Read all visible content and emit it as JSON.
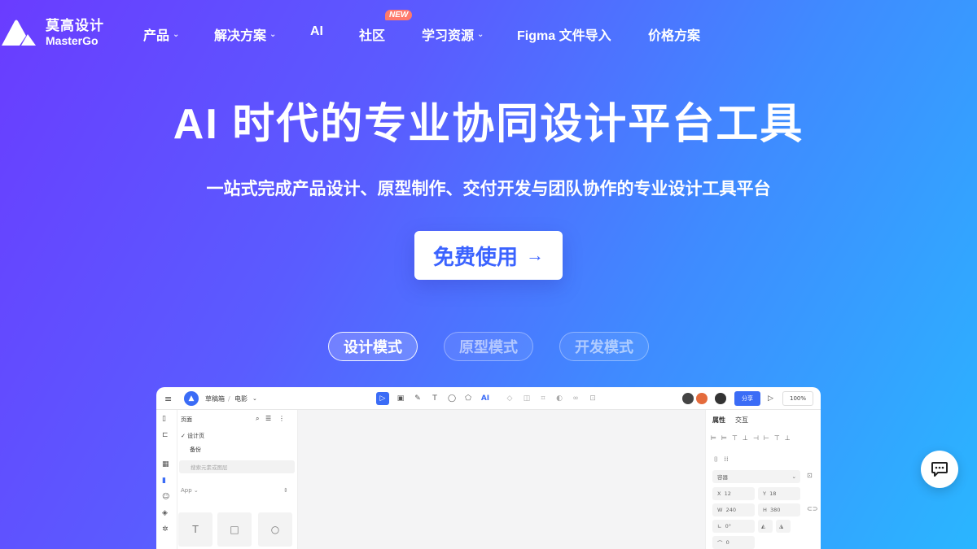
{
  "brand": {
    "name_cn": "莫高设计",
    "name_en": "MasterGo"
  },
  "nav": {
    "items": [
      {
        "label": "产品",
        "dropdown": true
      },
      {
        "label": "解决方案",
        "dropdown": true
      },
      {
        "label": "AI",
        "dropdown": false
      },
      {
        "label": "社区",
        "dropdown": false,
        "badge": "NEW"
      },
      {
        "label": "学习资源",
        "dropdown": true
      },
      {
        "label": "Figma 文件导入",
        "dropdown": false
      },
      {
        "label": "价格方案",
        "dropdown": false
      }
    ]
  },
  "hero": {
    "title": "AI 时代的专业协同设计平台工具",
    "subtitle": "一站式完成产品设计、原型制作、交付开发与团队协作的专业设计工具平台",
    "cta_label": "免费使用"
  },
  "tabs": [
    {
      "label": "设计模式",
      "active": true
    },
    {
      "label": "原型模式",
      "active": false
    },
    {
      "label": "开发模式",
      "active": false
    }
  ],
  "app": {
    "breadcrumb_team": "草稿箱",
    "breadcrumb_file": "电影",
    "ai_tool": "AI",
    "share_label": "分享",
    "zoom": "100%",
    "pages_header": "页面",
    "page_items": [
      "设计页",
      "备份"
    ],
    "search_placeholder": "搜索元素或图层",
    "library_select": "App",
    "props_tabs": [
      "属性",
      "交互"
    ],
    "frame_select": "容器",
    "x_label": "X",
    "x_value": "12",
    "y_label": "Y",
    "y_value": "18",
    "w_label": "W",
    "w_value": "240",
    "h_label": "H",
    "h_value": "380",
    "rotation_value": "0°",
    "radius_value": "0"
  },
  "colors": {
    "accent": "#3b6cf6",
    "badge": "#ff7a6b"
  },
  "icons": [
    "hamburger-icon",
    "chevron-down-icon",
    "arrow-right-icon",
    "chat-icon"
  ]
}
